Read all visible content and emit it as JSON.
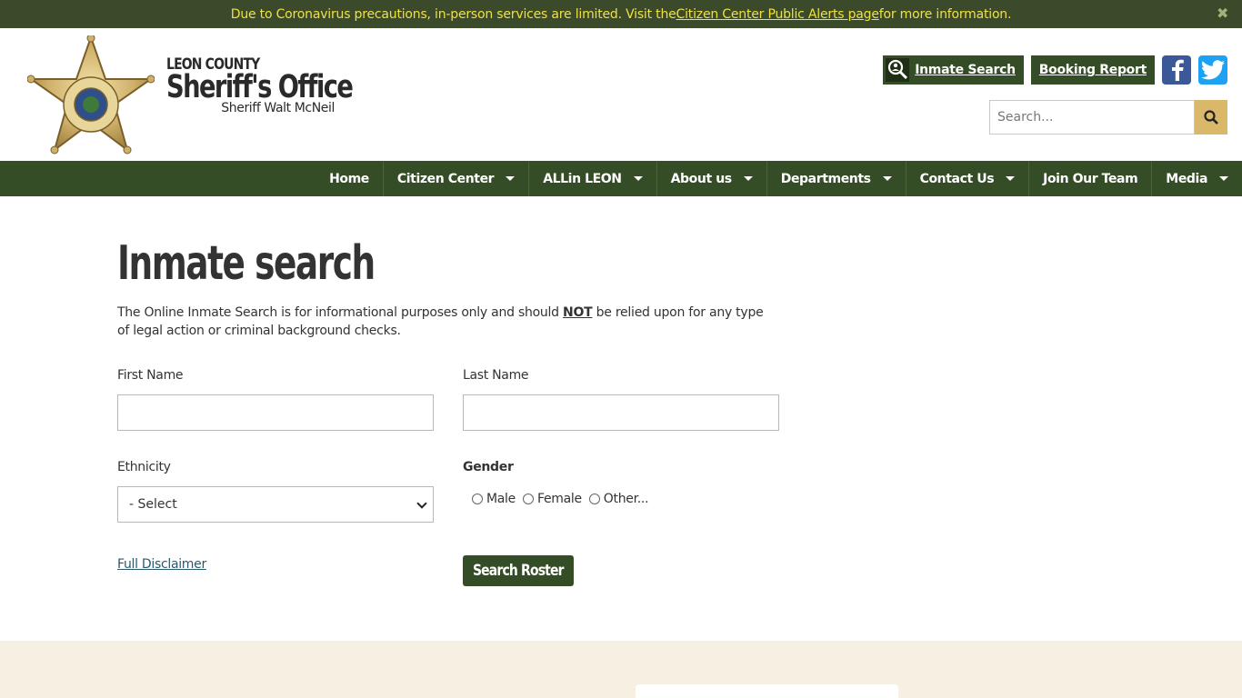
{
  "alert": {
    "text_before": "Due to Coronavirus precautions, in-person services are limited. Visit the ",
    "link_text": "Citizen Center Public Alerts page",
    "text_after": " for more information.",
    "close_glyph": "✖"
  },
  "brand": {
    "county": "LEON COUNTY",
    "office": "Sheriff's Office",
    "sheriff": "Sheriff Walt McNeil"
  },
  "top_links": {
    "inmate_search": "Inmate Search",
    "booking_report": "Booking Report"
  },
  "site_search": {
    "placeholder": "Search..."
  },
  "nav": {
    "items": [
      {
        "label": "Home",
        "dropdown": false
      },
      {
        "label": "Citizen Center",
        "dropdown": true
      },
      {
        "label": "ALLin LEON",
        "dropdown": true
      },
      {
        "label": "About us",
        "dropdown": true
      },
      {
        "label": "Departments",
        "dropdown": true
      },
      {
        "label": "Contact Us",
        "dropdown": true
      },
      {
        "label": "Join Our Team",
        "dropdown": false
      },
      {
        "label": "Media",
        "dropdown": true
      }
    ]
  },
  "main": {
    "title": "Inmate search",
    "intro_before": "The Online Inmate Search is for informational purposes only and should ",
    "intro_not": "NOT",
    "intro_after": " be relied upon for any type of legal action or criminal background checks."
  },
  "form": {
    "first_name_label": "First Name",
    "first_name_value": "",
    "last_name_label": "Last Name",
    "last_name_value": "",
    "ethnicity_label": "Ethnicity",
    "ethnicity_selected": "- Select",
    "gender_label": "Gender",
    "gender_options": [
      "Male",
      "Female",
      "Other..."
    ],
    "disclaimer_link": "Full Disclaimer",
    "submit_label": "Search Roster"
  },
  "colors": {
    "brand_green": "#354d26",
    "alert_bg": "#3a4a2a",
    "alert_text": "#f0e040",
    "search_button": "#d9b86a",
    "footer_bg": "#f6f0e2"
  },
  "icons": {
    "alert_close": "close-icon",
    "inmate_search": "magnifier-person-icon",
    "facebook": "facebook-icon",
    "twitter": "twitter-icon",
    "site_search": "search-icon",
    "nav_caret": "caret-down-icon",
    "select_chevron": "chevron-down-icon"
  }
}
